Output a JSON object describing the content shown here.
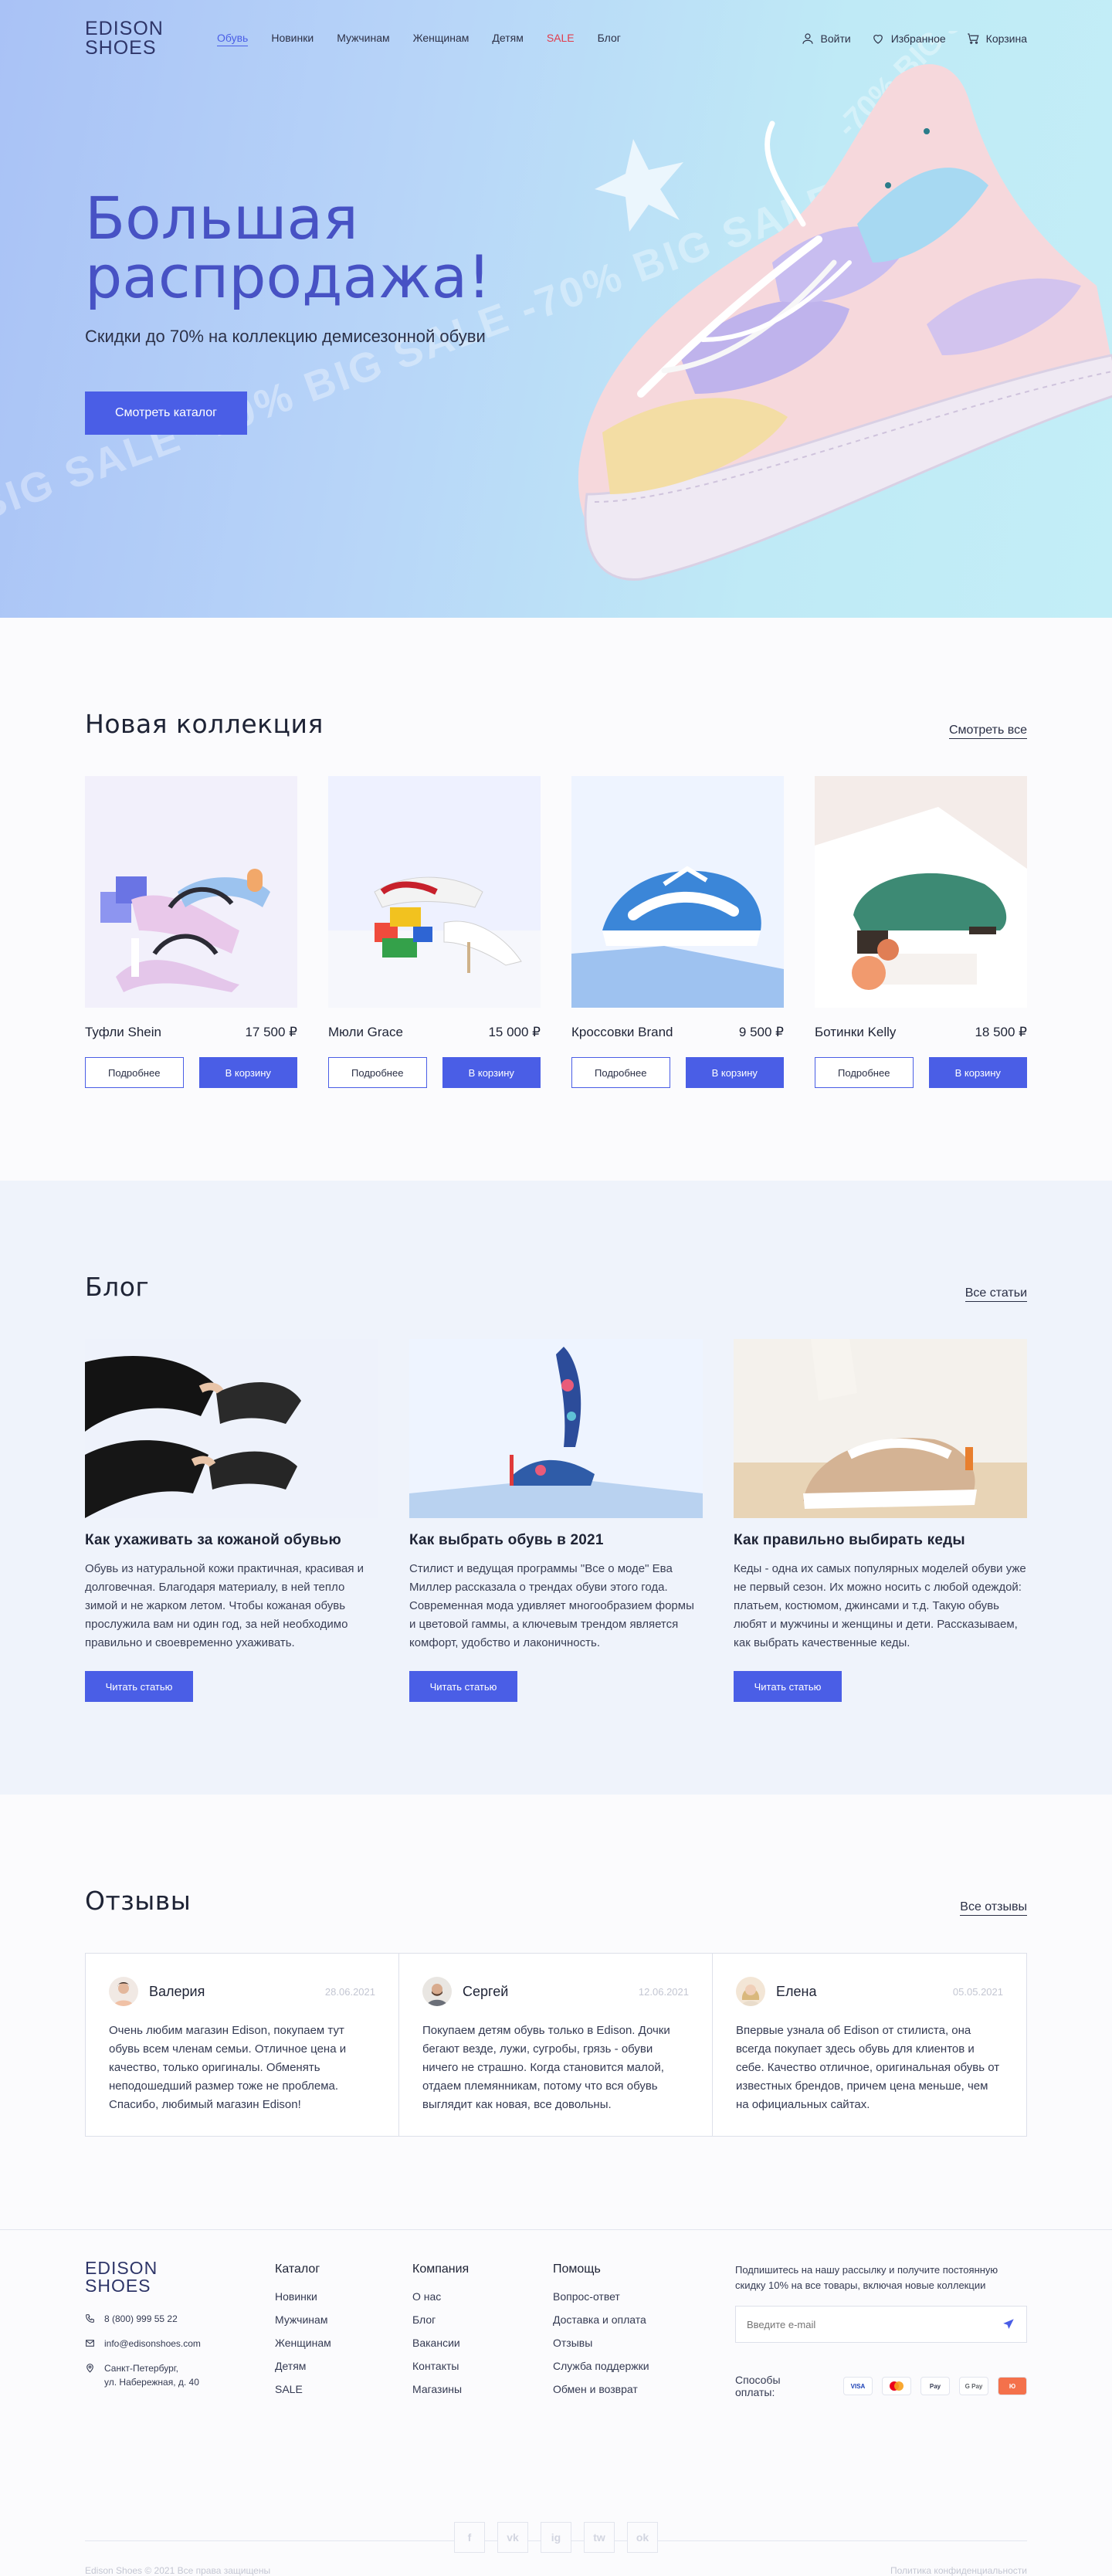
{
  "header": {
    "logo_line1": "EDISON",
    "logo_line2": "SHOES",
    "nav": [
      "Обувь",
      "Новинки",
      "Мужчинам",
      "Женщинам",
      "Детям",
      "SALE",
      "Блог"
    ],
    "login": "Войти",
    "favorites": "Избранное",
    "cart": "Корзина"
  },
  "hero": {
    "title": "Большая распродажа!",
    "subtitle": "Скидки до 70% на коллекцию демисезонной обуви",
    "button": "Смотреть каталог",
    "ribbon": "BIG SALE -70% BIG SALE -70% BIG SALE",
    "shoe_ribbon": "-70% BIG SALE -70% BIG SA"
  },
  "new_collection": {
    "title": "Новая коллекция",
    "link": "Смотреть все",
    "details_label": "Подробнее",
    "cart_label": "В корзину",
    "items": [
      {
        "name": "Туфли Shein",
        "price": "17 500 ₽"
      },
      {
        "name": "Мюли Grace",
        "price": "15 000 ₽"
      },
      {
        "name": "Кроссовки Brand",
        "price": "9 500 ₽"
      },
      {
        "name": "Ботинки Kelly",
        "price": "18 500 ₽"
      }
    ]
  },
  "blog": {
    "title": "Блог",
    "link": "Все статьи",
    "read_label": "Читать статью",
    "posts": [
      {
        "title": "Как ухаживать за кожаной обувью",
        "text": "Обувь из натуральной кожи практичная, красивая и долговечная. Благодаря материалу, в ней тепло зимой и не жарком летом. Чтобы кожаная обувь прослужила вам ни один год, за ней необходимо правильно и своевременно ухаживать."
      },
      {
        "title": "Как выбрать обувь в 2021",
        "text": "Стилист и ведущая программы \"Все о моде\" Ева Миллер рассказала о трендах обуви этого года. Современная мода удивляет многообразием формы и цветовой гаммы, а ключевым трендом является комфорт, удобство и лаконичность."
      },
      {
        "title": "Как правильно выбирать кеды",
        "text": "Кеды - одна их самых популярных моделей обуви уже не первый сезон. Их можно носить с любой одеждой: платьем, костюмом, джинсами и т.д. Такую обувь любят и мужчины и женщины и дети. Рассказываем, как выбрать качественные кеды."
      }
    ]
  },
  "reviews": {
    "title": "Отзывы",
    "link": "Все отзывы",
    "items": [
      {
        "name": "Валерия",
        "date": "28.06.2021",
        "text": "Очень любим магазин Edison, покупаем тут обувь всем членам семьи. Отличное цена и качество, только оригиналы. Обменять неподошедший размер тоже не проблема. Спасибо, любимый магазин Edison!"
      },
      {
        "name": "Сергей",
        "date": "12.06.2021",
        "text": "Покупаем детям обувь только в Edison. Дочки бегают везде, лужи, сугробы, грязь - обуви ничего не страшно. Когда становится малой, отдаем племянникам, потому что вся обувь выглядит как новая, все довольны."
      },
      {
        "name": "Елена",
        "date": "05.05.2021",
        "text": "Впервые узнала об Edison от стилиста, она всегда покупает здесь обувь для клиентов и себе. Качество отличное, оригинальная обувь от известных брендов, причем цена меньше, чем на официальных сайтах."
      }
    ]
  },
  "footer": {
    "logo_line1": "EDISON",
    "logo_line2": "SHOES",
    "phone": "8 (800) 999 55 22",
    "email": "info@edisonshoes.com",
    "address_line1": "Санкт-Петербург,",
    "address_line2": "ул. Набережная, д. 40",
    "columns": [
      {
        "title": "Каталог",
        "links": [
          "Новинки",
          "Мужчинам",
          "Женщинам",
          "Детям",
          "SALE"
        ]
      },
      {
        "title": "Компания",
        "links": [
          "О нас",
          "Блог",
          "Вакансии",
          "Контакты",
          "Магазины"
        ]
      },
      {
        "title": "Помощь",
        "links": [
          "Вопрос-ответ",
          "Доставка и оплата",
          "Отзывы",
          "Служба поддержки",
          "Обмен и возврат"
        ]
      }
    ],
    "subscribe_text": "Подпишитесь на нашу рассылку и получите постоянную скидку 10% на все товары, включая новые коллекции",
    "email_placeholder": "Введите e-mail",
    "payment_label": "Способы оплаты:",
    "payments": [
      "VISA",
      "MC",
      "Pay",
      "G Pay",
      "Ю"
    ],
    "socials": [
      "f",
      "vk",
      "ig",
      "tw",
      "ok"
    ],
    "copyright": "Edison Shoes © 2021 Все права защищены",
    "policy": "Политика конфиденциальности"
  },
  "colors": {
    "accent": "#4a5ee6",
    "sale": "#e23b4b",
    "title": "#4752c4"
  }
}
